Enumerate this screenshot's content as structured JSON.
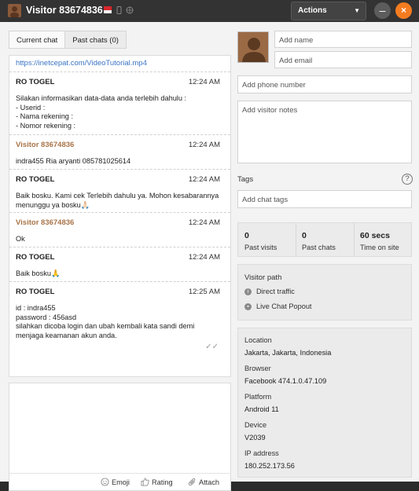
{
  "window": {
    "title": "Visitor 83674836",
    "actions_label": "Actions",
    "minimize_glyph": "–",
    "close_glyph": "×"
  },
  "tabs": [
    {
      "label": "Current chat"
    },
    {
      "label": "Past chats (0)"
    }
  ],
  "chat": {
    "link": "https://inetcepat.com/VideoTutorial.mp4",
    "messages": [
      {
        "sender": "RO TOGEL",
        "time": "12:24 AM",
        "text": "Silakan informasikan data-data anda terlebih dahulu :\n- Userid :\n- Nama rekening :\n- Nomor rekening :"
      },
      {
        "sender": "Visitor 83674836",
        "time": "12:24 AM",
        "text": "indra455 Ria aryanti 085781025614"
      },
      {
        "sender": "RO TOGEL",
        "time": "12:24 AM",
        "text": "Baik bosku. Kami cek Terlebih dahulu ya. Mohon kesabarannya menunggu ya bosku🙏🏻"
      },
      {
        "sender": "Visitor 83674836",
        "time": "12:24 AM",
        "text": "Ok"
      },
      {
        "sender": "RO TOGEL",
        "time": "12:24 AM",
        "text": "Baik bosku🙏"
      },
      {
        "sender": "RO TOGEL",
        "time": "12:25 AM",
        "text": "id : indra455\npassword : 456asd\nsilahkan dicoba login dan ubah kembali kata sandi demi menjaga keamanan akun anda."
      }
    ]
  },
  "compose": {
    "emoji_label": "Emoji",
    "rating_label": "Rating",
    "attach_label": "Attach"
  },
  "visitor": {
    "name_placeholder": "Add name",
    "email_placeholder": "Add email",
    "phone_placeholder": "Add phone number",
    "notes_placeholder": "Add visitor notes",
    "tags_label": "Tags",
    "tags_placeholder": "Add chat tags",
    "help_glyph": "?"
  },
  "stats": [
    {
      "value": "0",
      "caption": "Past visits"
    },
    {
      "value": "0",
      "caption": "Past chats"
    },
    {
      "value": "60 secs",
      "caption": "Time on site"
    }
  ],
  "path": {
    "title": "Visitor path",
    "items": [
      {
        "label": "Direct traffic"
      },
      {
        "label": "Live Chat Popout"
      }
    ]
  },
  "info": {
    "location_label": "Location",
    "location": "Jakarta, Jakarta, Indonesia",
    "browser_label": "Browser",
    "browser": "Facebook 474.1.0.47.109",
    "platform_label": "Platform",
    "platform": "Android 11",
    "device_label": "Device",
    "device": "V2039",
    "ip_label": "IP address",
    "ip": "180.252.173.56"
  },
  "colors": {
    "titlebar": "#333333",
    "close_button": "#f47c20",
    "visitor_name": "#a87448",
    "link": "#3a74c4"
  }
}
